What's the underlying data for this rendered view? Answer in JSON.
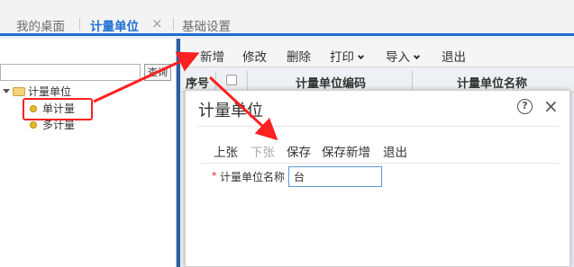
{
  "tabs": [
    {
      "label": "我的桌面"
    },
    {
      "label": "计量单位"
    },
    {
      "label": "基础设置"
    }
  ],
  "tab_close_symbol": "×",
  "left_panel": {
    "search_button_label": "查询",
    "tree": {
      "root_label": "计量单位",
      "items": [
        {
          "label": "单计量"
        },
        {
          "label": "多计量"
        }
      ]
    }
  },
  "toolbar": {
    "add_label": "新增",
    "edit_label": "修改",
    "delete_label": "删除",
    "print_label": "打印",
    "import_label": "导入",
    "exit_label": "退出"
  },
  "grid": {
    "columns": [
      "序号",
      "计量单位编码",
      "计量单位名称"
    ]
  },
  "dialog": {
    "title": "计量单位",
    "help_symbol": "?",
    "close_symbol": "×",
    "actions": {
      "prev_label": "上张",
      "next_label": "下张",
      "save_label": "保存",
      "save_new_label": "保存新增",
      "exit_label": "退出"
    },
    "field": {
      "required_mark": "*",
      "label": "计量单位名称",
      "value": "台"
    }
  },
  "colors": {
    "accent": "#1e6fd1",
    "highlight": "#ff2020",
    "divider": "#2c5fa4"
  }
}
